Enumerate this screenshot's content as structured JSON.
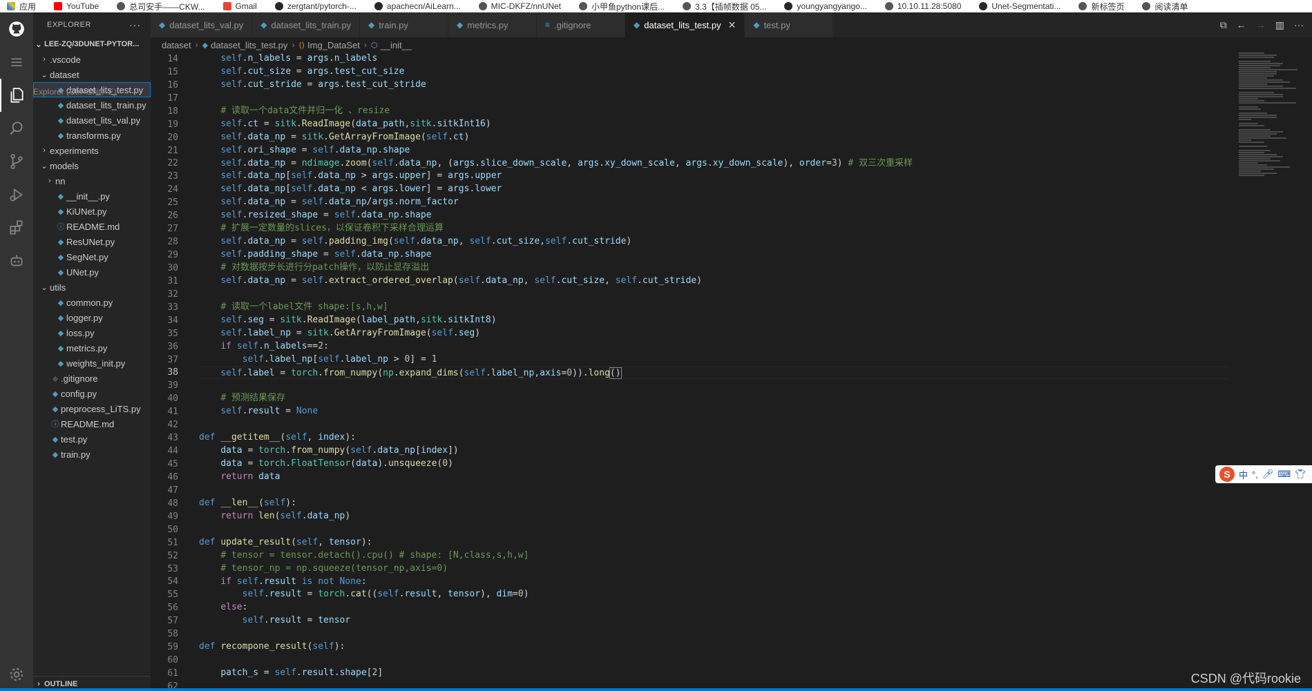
{
  "bookmarks": [
    "应用",
    "YouTube",
    "总司安手——CKW...",
    "Gmail",
    "zergtant/pytorch-...",
    "apachecn/AiLearn...",
    "MIC-DKFZ/nnUNet",
    "小甲鱼python课后...",
    "3.3【插帧数据 05...",
    "youngyangyango...",
    "10.10.11.28:5080",
    "Unet-Segmentati...",
    "新标签页",
    "阅读清单"
  ],
  "sidebar": {
    "title": "EXPLORER",
    "more": "···",
    "root": "LEE-ZQ/3DUNET-PYTOR...",
    "tooltip": "Explorer (Ctrl+Shift+E)",
    "items": [
      {
        "label": ".vscode",
        "type": "folder",
        "depth": 1,
        "open": false
      },
      {
        "label": "dataset",
        "type": "folder",
        "depth": 1,
        "open": true
      },
      {
        "label": "dataset_lits_test.py",
        "type": "py",
        "depth": 2,
        "selected": true
      },
      {
        "label": "dataset_lits_train.py",
        "type": "py",
        "depth": 2
      },
      {
        "label": "dataset_lits_val.py",
        "type": "py",
        "depth": 2
      },
      {
        "label": "transforms.py",
        "type": "py",
        "depth": 2
      },
      {
        "label": "experiments",
        "type": "folder",
        "depth": 1,
        "open": false
      },
      {
        "label": "models",
        "type": "folder",
        "depth": 1,
        "open": true
      },
      {
        "label": "nn",
        "type": "folder",
        "depth": 2,
        "open": false
      },
      {
        "label": "__init__.py",
        "type": "py",
        "depth": 2
      },
      {
        "label": "KiUNet.py",
        "type": "py",
        "depth": 2
      },
      {
        "label": "README.md",
        "type": "md",
        "depth": 2
      },
      {
        "label": "ResUNet.py",
        "type": "py",
        "depth": 2
      },
      {
        "label": "SegNet.py",
        "type": "py",
        "depth": 2
      },
      {
        "label": "UNet.py",
        "type": "py",
        "depth": 2
      },
      {
        "label": "utils",
        "type": "folder",
        "depth": 1,
        "open": true
      },
      {
        "label": "common.py",
        "type": "py",
        "depth": 2
      },
      {
        "label": "logger.py",
        "type": "py",
        "depth": 2
      },
      {
        "label": "loss.py",
        "type": "py",
        "depth": 2
      },
      {
        "label": "metrics.py",
        "type": "py",
        "depth": 2
      },
      {
        "label": "weights_init.py",
        "type": "py",
        "depth": 2
      },
      {
        "label": ".gitignore",
        "type": "git",
        "depth": 1
      },
      {
        "label": "config.py",
        "type": "py",
        "depth": 1
      },
      {
        "label": "preprocess_LiTS.py",
        "type": "py",
        "depth": 1
      },
      {
        "label": "README.md",
        "type": "md",
        "depth": 1
      },
      {
        "label": "test.py",
        "type": "py",
        "depth": 1
      },
      {
        "label": "train.py",
        "type": "py",
        "depth": 1
      }
    ],
    "outline": "OUTLINE"
  },
  "tabs": [
    {
      "label": "dataset_lits_val.py",
      "active": false
    },
    {
      "label": "dataset_lits_train.py",
      "active": false
    },
    {
      "label": "train.py",
      "active": false
    },
    {
      "label": "metrics.py",
      "active": false
    },
    {
      "label": ".gitignore",
      "active": false
    },
    {
      "label": "dataset_lits_test.py",
      "active": true
    },
    {
      "label": "test.py",
      "active": false
    }
  ],
  "breadcrumb": [
    "dataset",
    "dataset_lits_test.py",
    "Img_DataSet",
    "__init__"
  ],
  "current_line": 38,
  "ime_label": "中",
  "watermark": "CSDN @代码rookie"
}
